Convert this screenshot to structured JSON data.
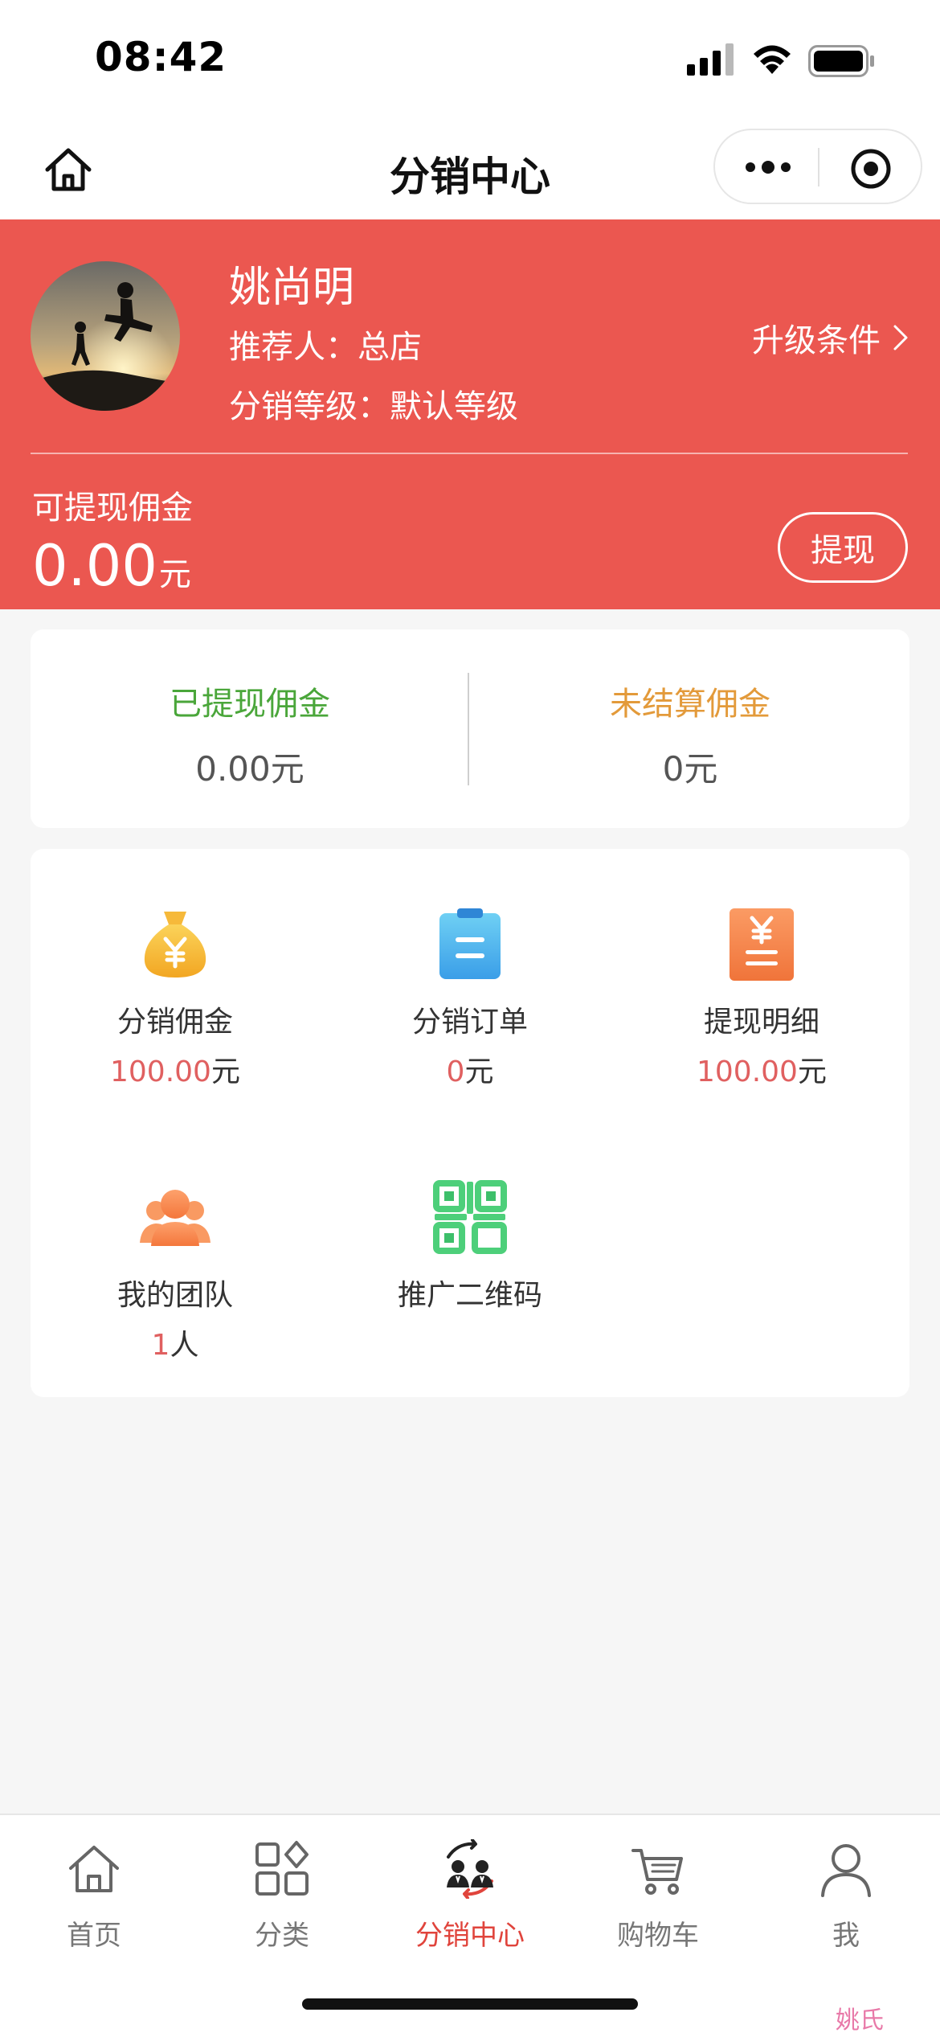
{
  "status_bar": {
    "time": "08:42"
  },
  "nav": {
    "title": "分销中心",
    "home_icon": "home-icon",
    "more_icon": "more-icon",
    "close_icon": "target-icon"
  },
  "profile": {
    "name": "姚尚明",
    "referrer": "推荐人：总店",
    "level": "分销等级：默认等级",
    "upgrade_label": "升级条件",
    "withdrawable_label": "可提现佣金",
    "withdrawable_amount": "0.00",
    "withdrawable_unit": "元",
    "withdraw_button": "提现"
  },
  "summary": {
    "withdrawn": {
      "title": "已提现佣金",
      "value": "0.00元"
    },
    "unsettled": {
      "title": "未结算佣金",
      "value": "0元"
    }
  },
  "grid": [
    {
      "label": "分销佣金",
      "value": "100.00",
      "unit": "元",
      "icon": "money-bag-icon"
    },
    {
      "label": "分销订单",
      "value": "0",
      "unit": "元",
      "icon": "clipboard-icon"
    },
    {
      "label": "提现明细",
      "value": "100.00",
      "unit": "元",
      "icon": "receipt-icon"
    },
    {
      "label": "我的团队",
      "value": "1",
      "unit": "人",
      "icon": "team-icon"
    },
    {
      "label": "推广二维码",
      "icon": "qr-code-icon"
    }
  ],
  "tabs": [
    {
      "label": "首页",
      "icon": "home-icon",
      "active": false
    },
    {
      "label": "分类",
      "icon": "category-icon",
      "active": false
    },
    {
      "label": "分销中心",
      "icon": "distribution-icon",
      "active": true
    },
    {
      "label": "购物车",
      "icon": "cart-icon",
      "active": false
    },
    {
      "label": "我",
      "icon": "user-icon",
      "active": false
    }
  ],
  "colors": {
    "header_red": "#eb5750",
    "accent_red": "#e0443c",
    "green": "#4aa63a",
    "orange": "#e39a3a",
    "value_red": "#e06060"
  },
  "watermark": "姚氏"
}
